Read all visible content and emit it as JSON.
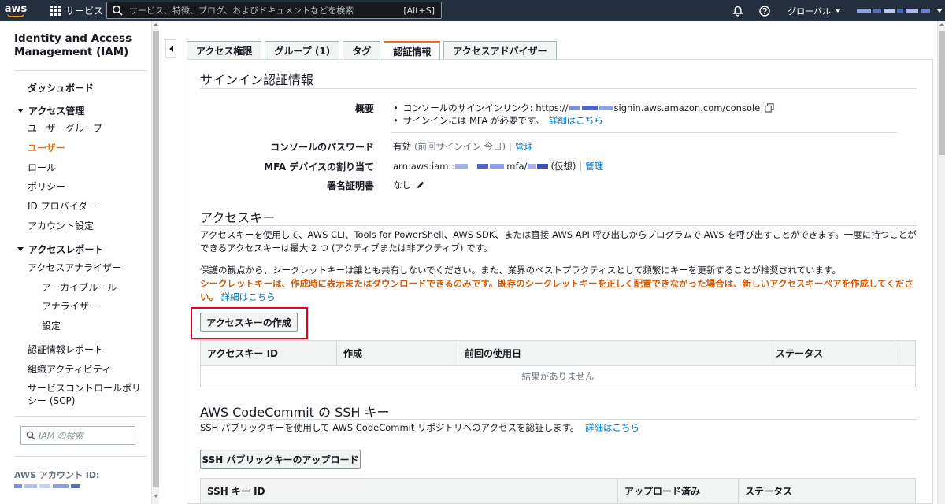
{
  "topnav": {
    "logo_text": "aws",
    "services_label": "サービス",
    "search_placeholder": "サービス、特徴、ブログ、およびドキュメントなどを検索",
    "search_shortcut": "[Alt+S]",
    "region_label": "グローバル"
  },
  "sidebar": {
    "title": "Identity and Access Management (IAM)",
    "dashboard": "ダッシュボード",
    "access_mgmt": "アクセス管理",
    "user_groups": "ユーザーグループ",
    "users": "ユーザー",
    "roles": "ロール",
    "policies": "ポリシー",
    "id_providers": "ID プロバイダー",
    "account_settings": "アカウント設定",
    "access_reports": "アクセスレポート",
    "access_analyzer": "アクセスアナライザー",
    "archive_rules": "アーカイブルール",
    "analyzers": "アナライザー",
    "settings": "設定",
    "credential_report": "認証情報レポート",
    "org_activity": "組織アクティビティ",
    "scp": "サービスコントロールポリシー (SCP)",
    "search_placeholder": "IAM の検索",
    "account_id_label": "AWS アカウント ID:"
  },
  "tabs": [
    "アクセス権限",
    "グループ (1)",
    "タグ",
    "認証情報",
    "アクセスアドバイザー"
  ],
  "active_tab_index": 3,
  "signin": {
    "heading": "サインイン認証情報",
    "summary_label": "概要",
    "console_link_prefix": "コンソールのサインインリンク: https://",
    "console_link_suffix": "signin.aws.amazon.com/console",
    "mfa_required": "サインインには MFA が必要です。",
    "details_link": "詳細はこちら",
    "password_label": "コンソールのパスワード",
    "password_status": "有効",
    "password_last": "(前回サインイン 今日)",
    "manage": "管理",
    "mfa_label": "MFA デバイスの割り当て",
    "mfa_arn_prefix": "arn:aws:iam::",
    "mfa_mid": "mfa/",
    "mfa_virtual": "(仮想)",
    "cert_label": "署名証明書",
    "cert_value": "なし"
  },
  "access_keys": {
    "heading": "アクセスキー",
    "desc": "アクセスキーを使用して、AWS CLI、Tools for PowerShell、AWS SDK、または直接 AWS API 呼び出しからプログラムで AWS を呼び出すことができます。一度に持つことができるアクセスキーは最大 2 つ (アクティブまたは非アクティブ) です。",
    "security_note": "保護の観点から、シークレットキーは誰とも共有しないでください。また、業界のベストプラクティスとして頻繁にキーを更新することが推奨されています。",
    "warning": "シークレットキーは、作成時に表示またはダウンロードできるのみです。既存のシークレットキーを正しく配置できなかった場合は、新しいアクセスキーペアを作成してください。",
    "warning_link": "詳細はこちら",
    "create_button": "アクセスキーの作成",
    "columns": [
      "アクセスキー ID",
      "作成",
      "前回の使用日",
      "ステータス"
    ],
    "empty": "結果がありません"
  },
  "ssh": {
    "heading": "AWS CodeCommit の SSH キー",
    "desc": "SSH パブリックキーを使用して AWS CodeCommit リポジトリへのアクセスを認証します。",
    "link": "詳細はこちら",
    "upload_button": "SSH パブリックキーのアップロード",
    "columns": [
      "SSH キー ID",
      "アップロード済み",
      "ステータス"
    ]
  },
  "colors": {
    "nav_bg": "#232f3e",
    "accent": "#ec7211",
    "link": "#0073bb",
    "warning": "#d45b07",
    "highlight_border": "#e8001c"
  },
  "icons": [
    "aws-logo",
    "services-grid-icon",
    "search-icon",
    "bell-icon",
    "help-icon",
    "copy-icon",
    "pencil-icon",
    "collapse-icon"
  ]
}
